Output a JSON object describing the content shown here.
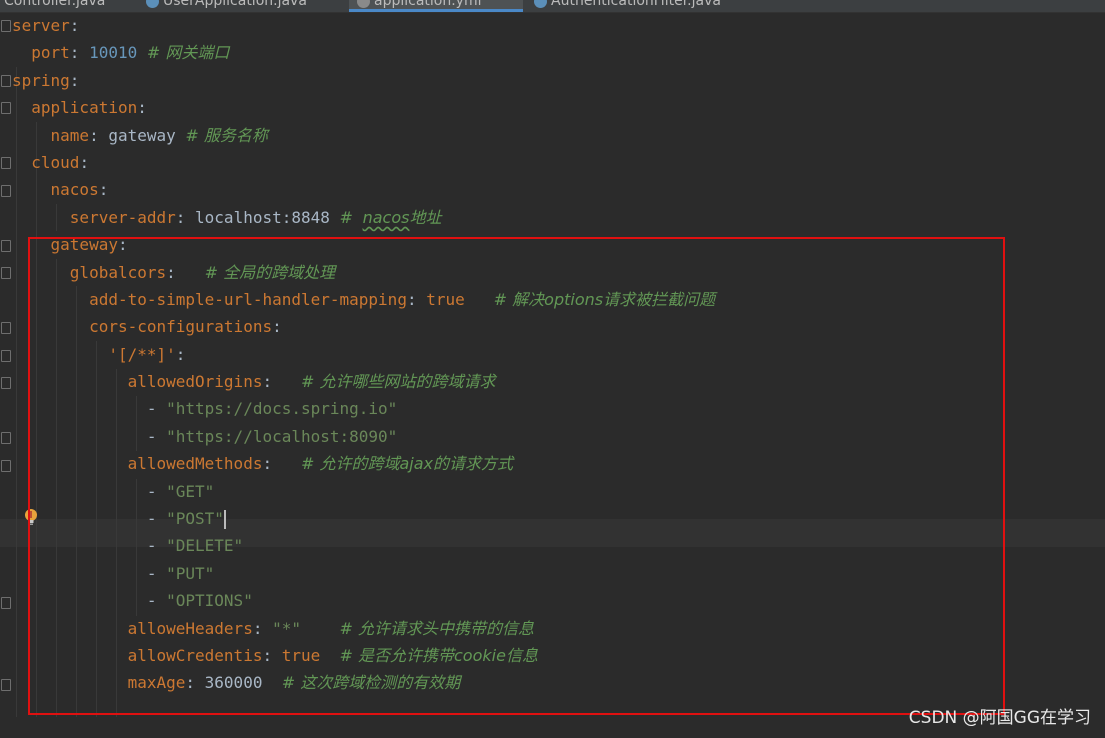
{
  "tabs": [
    {
      "label": "Controller.java",
      "active": false
    },
    {
      "label": "UserApplication.java",
      "active": false
    },
    {
      "label": "application.yml",
      "active": true
    },
    {
      "label": "AuthenticationFilter.java",
      "active": false
    }
  ],
  "code": {
    "server": "server",
    "port_key": "port",
    "port_value": "10010",
    "port_comment": "# 网关端口",
    "spring": "spring",
    "application": "application",
    "name_key": "name",
    "name_value": "gateway",
    "name_comment": "# 服务名称",
    "cloud": "cloud",
    "nacos": "nacos",
    "server_addr_key": "server-addr",
    "server_addr_value": "localhost:8848",
    "server_addr_comment_hash": "#",
    "server_addr_comment_word": "nacos",
    "server_addr_comment_rest": "地址",
    "gateway": "gateway",
    "globalcors": "globalcors",
    "globalcors_comment": "# 全局的跨域处理",
    "add_mapping_key": "add-to-simple-url-handler-mapping",
    "add_mapping_value": "true",
    "add_mapping_comment": "# 解决options请求被拦截问题",
    "cors_configurations": "cors-configurations",
    "path_pattern": "'[/**]'",
    "allowed_origins": "allowedOrigins",
    "allowed_origins_comment": "# 允许哪些网站的跨域请求",
    "origin_1": "\"https://docs.spring.io\"",
    "origin_2": "\"https://localhost:8090\"",
    "allowed_methods": "allowedMethods",
    "allowed_methods_comment": "# 允许的跨域ajax的请求方式",
    "method_get": "\"GET\"",
    "method_post": "\"POST\"",
    "method_delete": "\"DELETE\"",
    "method_put": "\"PUT\"",
    "method_options": "\"OPTIONS\"",
    "allowe_headers": "alloweHeaders",
    "allowe_headers_value": "\"*\"",
    "allowe_headers_comment": "# 允许请求头中携带的信息",
    "allow_credentis": "allowCredentis",
    "allow_credentis_value": "true",
    "allow_credentis_comment": "# 是否允许携带cookie信息",
    "max_age": "maxAge",
    "max_age_value": "360000",
    "max_age_comment": "# 这次跨域检测的有效期"
  },
  "watermark": "CSDN @阿国GG在学习",
  "colors": {
    "editor_bg": "#2b2b2b",
    "keyword": "#cc7832",
    "number": "#6897bb",
    "string": "#6a8759",
    "comment": "#629755",
    "highlight_box": "#e01010"
  }
}
